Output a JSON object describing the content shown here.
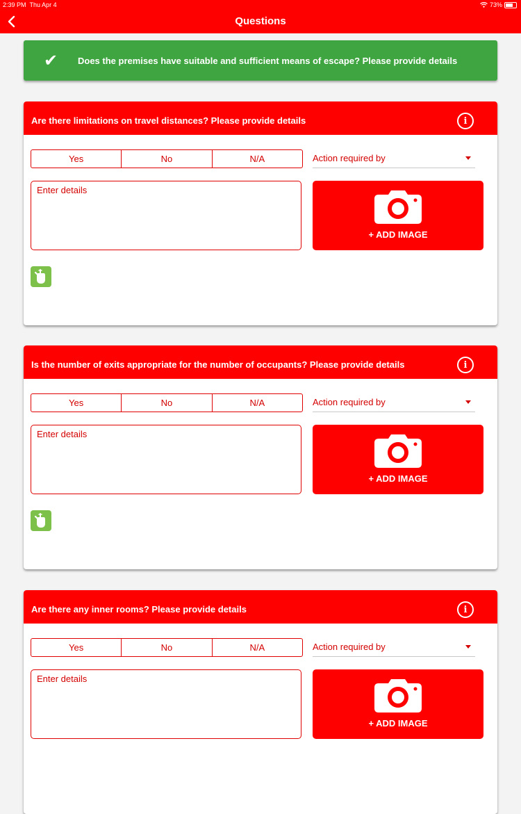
{
  "status_bar": {
    "time": "2:39 PM",
    "date": "Thu Apr 4",
    "battery": "73%"
  },
  "nav": {
    "title": "Questions"
  },
  "banner": {
    "text": "Does the premises have suitable and sufficient means of escape? Please provide details"
  },
  "colors": {
    "brand_red": "#ff0000",
    "success_green": "#3fa540",
    "glove_green": "#7dc04a"
  },
  "icons": {
    "back": "chevron-left-icon",
    "info": "info-icon",
    "camera": "camera-icon",
    "glove": "glove-icon",
    "check": "checkmark-icon"
  },
  "cards": [
    {
      "question": "Are there limitations on travel distances? Please provide details",
      "options": [
        "Yes",
        "No",
        "N/A"
      ],
      "action_placeholder": "Action required by",
      "details_placeholder": "Enter details",
      "add_image_label": "+ ADD IMAGE"
    },
    {
      "question": "Is the number of exits appropriate for the number of occupants? Please provide details",
      "options": [
        "Yes",
        "No",
        "N/A"
      ],
      "action_placeholder": "Action required by",
      "details_placeholder": "Enter details",
      "add_image_label": "+ ADD IMAGE"
    },
    {
      "question": "Are there any inner rooms? Please provide details",
      "options": [
        "Yes",
        "No",
        "N/A"
      ],
      "action_placeholder": "Action required by",
      "details_placeholder": "Enter details",
      "add_image_label": "+ ADD IMAGE"
    }
  ]
}
